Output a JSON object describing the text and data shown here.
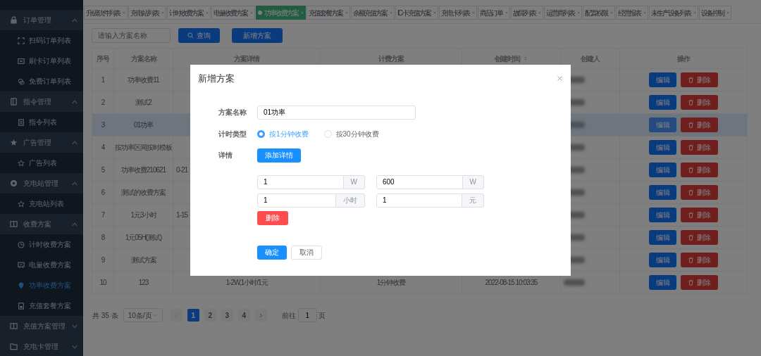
{
  "sidebar": {
    "items": [
      {
        "label": "订单管理",
        "expanded": true,
        "children": [
          {
            "label": "扫码订单列表",
            "selected": false
          },
          {
            "label": "刷卡订单列表",
            "selected": false
          },
          {
            "label": "免费订单列表",
            "selected": false
          }
        ]
      },
      {
        "label": "指令管理",
        "expanded": true,
        "children": [
          {
            "label": "指令列表",
            "selected": false
          }
        ]
      },
      {
        "label": "广告管理",
        "expanded": true,
        "children": [
          {
            "label": "广告列表",
            "selected": false
          }
        ]
      },
      {
        "label": "充电站管理",
        "expanded": true,
        "children": [
          {
            "label": "充电站列表",
            "selected": false
          }
        ]
      },
      {
        "label": "收费方案",
        "expanded": true,
        "children": [
          {
            "label": "计时收费方案",
            "selected": false
          },
          {
            "label": "电量收费方案",
            "selected": false
          },
          {
            "label": "功率收费方案",
            "selected": true
          },
          {
            "label": "充值套餐方案",
            "selected": false
          }
        ]
      },
      {
        "label": "充值方案管理",
        "expanded": false
      },
      {
        "label": "充电卡管理",
        "expanded": false
      }
    ]
  },
  "tabs": [
    {
      "label": "升级软件列表",
      "selected": false
    },
    {
      "label": "充电站列表",
      "selected": false
    },
    {
      "label": "计时收费方案",
      "selected": false
    },
    {
      "label": "电量收费方案",
      "selected": false
    },
    {
      "label": "功率收费方案",
      "selected": true
    },
    {
      "label": "充值套餐方案",
      "selected": false
    },
    {
      "label": "余额充值方案",
      "selected": false
    },
    {
      "label": "IC-卡充值方案",
      "selected": false
    },
    {
      "label": "充电卡列表",
      "selected": false
    },
    {
      "label": "商品订单",
      "selected": false
    },
    {
      "label": "故障列表",
      "selected": false
    },
    {
      "label": "运营商列表",
      "selected": false
    },
    {
      "label": "配置权限",
      "selected": false
    },
    {
      "label": "经营报表",
      "selected": false
    },
    {
      "label": "未生产设备列表",
      "selected": false
    },
    {
      "label": "设备控制",
      "selected": false
    }
  ],
  "toolbar": {
    "search": {
      "placeholder": "请输入方案名称"
    },
    "query_button": "查询",
    "add_button": "新增方案"
  },
  "table": {
    "columns": [
      {
        "label": "序号",
        "sortable": false
      },
      {
        "label": "方案名称",
        "sortable": false
      },
      {
        "label": "方案详情",
        "sortable": false
      },
      {
        "label": "计费方案",
        "sortable": false
      },
      {
        "label": "创建时间",
        "sortable": true
      },
      {
        "label": "创建人",
        "sortable": false
      },
      {
        "label": "操作",
        "sortable": false
      }
    ],
    "rows": [
      {
        "index": "1",
        "name": "功率收费11",
        "creator": {
          "kind": "blurred"
        },
        "highlighted": false,
        "edit": "编辑",
        "delete": "删除"
      },
      {
        "index": "2",
        "name": "测试2",
        "creator": {
          "kind": "blurred"
        },
        "highlighted": false,
        "edit": "编辑",
        "delete": "删除"
      },
      {
        "index": "3",
        "name": "01功率",
        "creator": {
          "kind": "blurred"
        },
        "highlighted": true,
        "edit": "编辑",
        "delete": "删除"
      },
      {
        "index": "4",
        "name": "按功率区间按时模板",
        "creator": {
          "kind": "blurred"
        },
        "highlighted": false,
        "edit": "编辑",
        "delete": "删除"
      },
      {
        "index": "5",
        "name": "功率收费210621",
        "details": "0-21",
        "creator": {
          "kind": "blurred"
        },
        "highlighted": false,
        "edit": "编辑",
        "delete": "删除"
      },
      {
        "index": "6",
        "name": "测试的收费方案",
        "creator": {
          "kind": "blurred"
        },
        "highlighted": false,
        "edit": "编辑",
        "delete": "删除"
      },
      {
        "index": "7",
        "name": "1元3小时",
        "details": "1-15",
        "creator": {
          "kind": "blurred"
        },
        "highlighted": false,
        "edit": "编辑",
        "delete": "删除"
      },
      {
        "index": "8",
        "name": "1元05H(测试)",
        "creator": {
          "kind": "blurred"
        },
        "highlighted": false,
        "edit": "编辑",
        "delete": "删除"
      },
      {
        "index": "9",
        "name": "测试方案",
        "creator": {
          "kind": "blurred"
        },
        "highlighted": false,
        "edit": "编辑",
        "delete": "删除"
      },
      {
        "index": "10",
        "name": "123",
        "details": "1-2W,1小时/1元",
        "plan": "1分钟收费",
        "created": "2022-08-15 10:03:35",
        "creator": {
          "kind": "blurred"
        },
        "highlighted": false,
        "edit": "编辑",
        "delete": "删除"
      }
    ]
  },
  "pagination": {
    "total": "共 35 条",
    "page_size": "10条/页",
    "pages": [
      {
        "label": "1",
        "selected": true
      },
      {
        "label": "2",
        "selected": false
      },
      {
        "label": "3",
        "selected": false
      },
      {
        "label": "4",
        "selected": false
      }
    ],
    "goto_label": "前往",
    "goto_value": "1",
    "goto_suffix": "页"
  },
  "modal": {
    "title": "新增方案",
    "name_label": "方案名称",
    "name_value": "01功率",
    "type_label": "计时类型",
    "options": [
      {
        "label": "按1分钟收费",
        "selected": true
      },
      {
        "label": "按30分钟收费",
        "selected": false
      }
    ],
    "details_label": "详情",
    "add_detail_button": "添加详情",
    "detail_rows": [
      [
        {
          "value": "1",
          "unit": "W"
        },
        {
          "value": "600",
          "unit": "W"
        }
      ],
      [
        {
          "value": "1",
          "unit": "小时"
        },
        {
          "value": "1",
          "unit": "元"
        }
      ]
    ],
    "remove_button": "删除",
    "confirm_button": "确定",
    "cancel_button": "取消"
  }
}
